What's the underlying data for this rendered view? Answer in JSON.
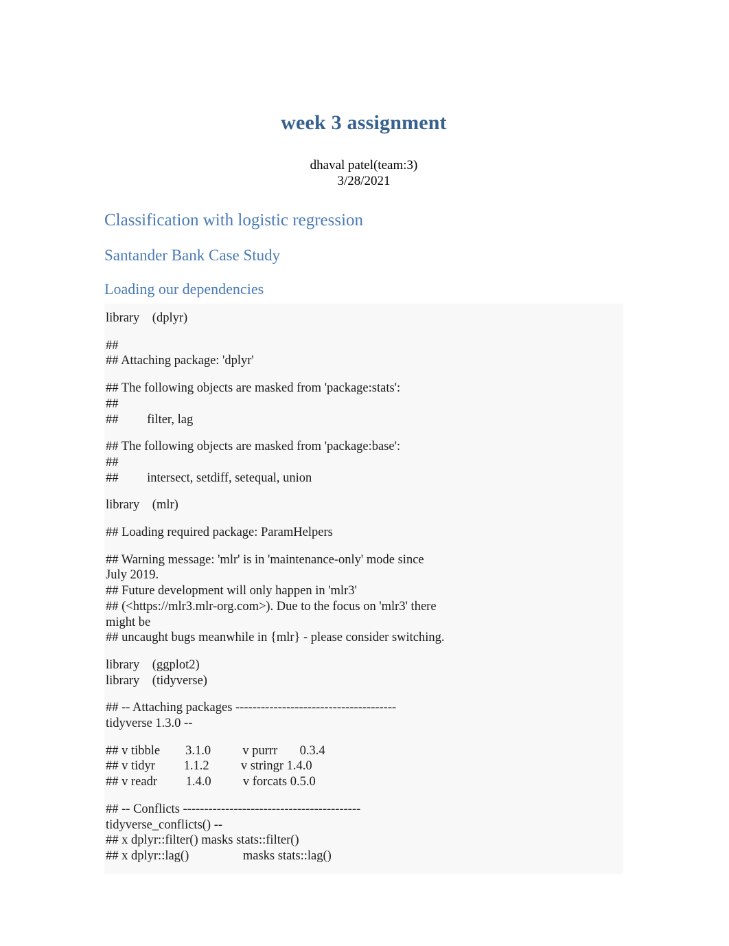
{
  "document": {
    "title": "week 3 assignment",
    "author": "dhaval patel(team:3)",
    "date": "3/28/2021",
    "title_color": "#36618e",
    "heading_color": "#4a7ab5",
    "code_background": "#f8f8f8",
    "body_background": "#ffffff"
  },
  "headings": {
    "h1": "Classification with logistic regression",
    "h2": "Santander Bank Case Study",
    "h3": "Loading our dependencies"
  },
  "code_block": {
    "groups": [
      {
        "lines": [
          "library    (dplyr)"
        ]
      },
      {
        "lines": [
          "## ",
          "## Attaching package: 'dplyr'"
        ]
      },
      {
        "lines": [
          "## The following objects are masked from 'package:stats':",
          "## ",
          "##         filter, lag"
        ]
      },
      {
        "lines": [
          "## The following objects are masked from 'package:base':",
          "## ",
          "##         intersect, setdiff, setequal, union"
        ]
      },
      {
        "lines": [
          "library    (mlr)"
        ]
      },
      {
        "lines": [
          "## Loading required package: ParamHelpers"
        ]
      },
      {
        "lines": [
          "## Warning message: 'mlr' is in 'maintenance-only' mode since",
          "July 2019.",
          "## Future development will only happen in 'mlr3'",
          "## (<https://mlr3.mlr-org.com>). Due to the focus on 'mlr3' there",
          "might be",
          "## uncaught bugs meanwhile in {mlr} - please consider switching."
        ]
      },
      {
        "lines": [
          "library    (ggplot2)",
          "library    (tidyverse)"
        ]
      },
      {
        "lines": [
          "## -- Attaching packages --------------------------------------",
          "tidyverse 1.3.0 --"
        ]
      },
      {
        "lines": [
          "## v tibble        3.1.0          v purrr       0.3.4",
          "## v tidyr         1.1.2          v stringr 1.4.0",
          "## v readr         1.4.0          v forcats 0.5.0"
        ]
      },
      {
        "lines": [
          "## -- Conflicts ------------------------------------------",
          "tidyverse_conflicts() --",
          "## x dplyr::filter() masks stats::filter()",
          "## x dplyr::lag()                 masks stats::lag()"
        ]
      }
    ]
  }
}
